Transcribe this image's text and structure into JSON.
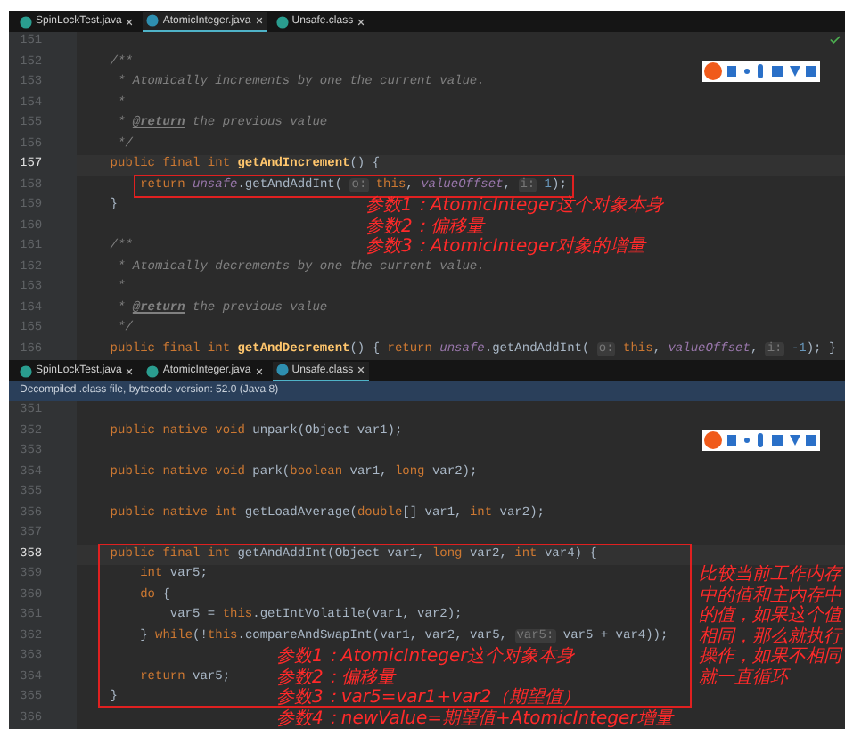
{
  "top_editor": {
    "tabs": [
      {
        "label": "SpinLockTest.java",
        "selected": false
      },
      {
        "label": "AtomicInteger.java",
        "selected": true
      },
      {
        "label": "Unsafe.class",
        "selected": false
      }
    ],
    "lines": [
      {
        "number": "151",
        "current": false
      },
      {
        "number": "152",
        "current": false,
        "tokens": [
          {
            "text": "    /**",
            "kind": "comment"
          }
        ]
      },
      {
        "number": "153",
        "current": false,
        "tokens": [
          {
            "text": "     * Atomically increments by one the current value.",
            "kind": "comment"
          }
        ]
      },
      {
        "number": "154",
        "current": false,
        "tokens": [
          {
            "text": "     *",
            "kind": "comment"
          }
        ]
      },
      {
        "number": "155",
        "current": false,
        "tokens": [
          {
            "text": "     * ",
            "kind": "comment"
          },
          {
            "text": "@return",
            "kind": "tag"
          },
          {
            "text": " the previous value",
            "kind": "comment"
          }
        ]
      },
      {
        "number": "156",
        "current": false,
        "tokens": [
          {
            "text": "     */",
            "kind": "comment"
          }
        ]
      },
      {
        "number": "157",
        "current": true,
        "tokens": [
          {
            "text": "    public final int ",
            "kind": "keyword"
          },
          {
            "text": "getAndIncrement",
            "kind": "method"
          },
          {
            "text": "() {",
            "kind": "plain"
          }
        ]
      },
      {
        "number": "158",
        "current": false,
        "tokens": [
          {
            "text": "        return ",
            "kind": "keyword"
          },
          {
            "text": "unsafe",
            "kind": "field"
          },
          {
            "text": ".getAndAddInt( ",
            "kind": "plain"
          },
          {
            "text": "o:",
            "kind": "hint"
          },
          {
            "text": " this",
            "kind": "keyword"
          },
          {
            "text": ", ",
            "kind": "plain"
          },
          {
            "text": "valueOffset",
            "kind": "field"
          },
          {
            "text": ", ",
            "kind": "plain"
          },
          {
            "text": "i:",
            "kind": "hint"
          },
          {
            "text": " 1",
            "kind": "number"
          },
          {
            "text": ");",
            "kind": "plain"
          }
        ]
      },
      {
        "number": "159",
        "current": false,
        "tokens": [
          {
            "text": "    }",
            "kind": "plain"
          }
        ]
      },
      {
        "number": "160",
        "current": false
      },
      {
        "number": "161",
        "current": false,
        "tokens": [
          {
            "text": "    /**",
            "kind": "comment"
          }
        ]
      },
      {
        "number": "162",
        "current": false,
        "tokens": [
          {
            "text": "     * Atomically decrements by one the current value.",
            "kind": "comment"
          }
        ]
      },
      {
        "number": "163",
        "current": false,
        "tokens": [
          {
            "text": "     *",
            "kind": "comment"
          }
        ]
      },
      {
        "number": "164",
        "current": false,
        "tokens": [
          {
            "text": "     * ",
            "kind": "comment"
          },
          {
            "text": "@return",
            "kind": "tag"
          },
          {
            "text": " the previous value",
            "kind": "comment"
          }
        ]
      },
      {
        "number": "165",
        "current": false,
        "tokens": [
          {
            "text": "     */",
            "kind": "comment"
          }
        ]
      },
      {
        "number": "166",
        "current": false,
        "tokens": [
          {
            "text": "    public final int ",
            "kind": "keyword"
          },
          {
            "text": "getAndDecrement",
            "kind": "method"
          },
          {
            "text": "() { ",
            "kind": "plain"
          },
          {
            "text": "return ",
            "kind": "keyword"
          },
          {
            "text": "unsafe",
            "kind": "field"
          },
          {
            "text": ".getAndAddInt( ",
            "kind": "plain"
          },
          {
            "text": "o:",
            "kind": "hint"
          },
          {
            "text": " this",
            "kind": "keyword"
          },
          {
            "text": ", ",
            "kind": "plain"
          },
          {
            "text": "valueOffset",
            "kind": "field"
          },
          {
            "text": ", ",
            "kind": "plain"
          },
          {
            "text": "i:",
            "kind": "hint"
          },
          {
            "text": " -1",
            "kind": "number"
          },
          {
            "text": "); }",
            "kind": "plain"
          }
        ]
      }
    ],
    "annotations": [
      "参数1：AtomicInteger这个对象本身",
      "参数2：偏移量",
      "参数3：AtomicInteger对象的增量"
    ]
  },
  "bottom_editor": {
    "tabs": [
      {
        "label": "SpinLockTest.java",
        "selected": false
      },
      {
        "label": "AtomicInteger.java",
        "selected": false
      },
      {
        "label": "Unsafe.class",
        "selected": true
      }
    ],
    "info_bar": "Decompiled .class file, bytecode version: 52.0 (Java 8)",
    "lines": [
      {
        "number": "351",
        "current": false
      },
      {
        "number": "352",
        "current": false,
        "tokens": [
          {
            "text": "    public native void ",
            "kind": "keyword"
          },
          {
            "text": "unpark(Object var1);",
            "kind": "plain"
          }
        ]
      },
      {
        "number": "353",
        "current": false
      },
      {
        "number": "354",
        "current": false,
        "tokens": [
          {
            "text": "    public native void ",
            "kind": "keyword"
          },
          {
            "text": "park(",
            "kind": "plain"
          },
          {
            "text": "boolean",
            "kind": "keyword"
          },
          {
            "text": " var1, ",
            "kind": "plain"
          },
          {
            "text": "long",
            "kind": "keyword"
          },
          {
            "text": " var2);",
            "kind": "plain"
          }
        ]
      },
      {
        "number": "355",
        "current": false
      },
      {
        "number": "356",
        "current": false,
        "tokens": [
          {
            "text": "    public native int ",
            "kind": "keyword"
          },
          {
            "text": "getLoadAverage(",
            "kind": "plain"
          },
          {
            "text": "double",
            "kind": "keyword"
          },
          {
            "text": "[] var1, ",
            "kind": "plain"
          },
          {
            "text": "int",
            "kind": "keyword"
          },
          {
            "text": " var2);",
            "kind": "plain"
          }
        ]
      },
      {
        "number": "357",
        "current": false
      },
      {
        "number": "358",
        "current": true,
        "tokens": [
          {
            "text": "    public final int ",
            "kind": "keyword"
          },
          {
            "text": "getAndAddInt(Object var1, ",
            "kind": "plain"
          },
          {
            "text": "long",
            "kind": "keyword"
          },
          {
            "text": " var2, ",
            "kind": "plain"
          },
          {
            "text": "int",
            "kind": "keyword"
          },
          {
            "text": " var4) {",
            "kind": "plain"
          }
        ]
      },
      {
        "number": "359",
        "current": false,
        "tokens": [
          {
            "text": "        int ",
            "kind": "keyword"
          },
          {
            "text": "var5;",
            "kind": "plain"
          }
        ]
      },
      {
        "number": "360",
        "current": false,
        "tokens": [
          {
            "text": "        do ",
            "kind": "keyword"
          },
          {
            "text": "{",
            "kind": "plain"
          }
        ]
      },
      {
        "number": "361",
        "current": false,
        "tokens": [
          {
            "text": "            var5 = ",
            "kind": "plain"
          },
          {
            "text": "this",
            "kind": "keyword"
          },
          {
            "text": ".getIntVolatile(var1, var2);",
            "kind": "plain"
          }
        ]
      },
      {
        "number": "362",
        "current": false,
        "tokens": [
          {
            "text": "        } ",
            "kind": "plain"
          },
          {
            "text": "while",
            "kind": "keyword"
          },
          {
            "text": "(!",
            "kind": "plain"
          },
          {
            "text": "this",
            "kind": "keyword"
          },
          {
            "text": ".compareAndSwapInt(var1, var2, var5, ",
            "kind": "plain"
          },
          {
            "text": "var5:",
            "kind": "hint"
          },
          {
            "text": " var5 + var4));",
            "kind": "plain"
          }
        ]
      },
      {
        "number": "363",
        "current": false
      },
      {
        "number": "364",
        "current": false,
        "tokens": [
          {
            "text": "        return ",
            "kind": "keyword"
          },
          {
            "text": "var5;",
            "kind": "plain"
          }
        ]
      },
      {
        "number": "365",
        "current": false,
        "tokens": [
          {
            "text": "    }",
            "kind": "plain"
          }
        ]
      },
      {
        "number": "366",
        "current": false
      }
    ],
    "annotations": [
      "参数1：AtomicInteger这个对象本身",
      "参数2：偏移量",
      "参数3：var5=var1+var2（期望值）",
      "参数4：newValue=期望值+AtomicInteger增量"
    ],
    "side_note": "比较当前工作内存中的值和主内存中的值，如果这个值相同，那么就执行操作，如果不相同就一直循环"
  }
}
